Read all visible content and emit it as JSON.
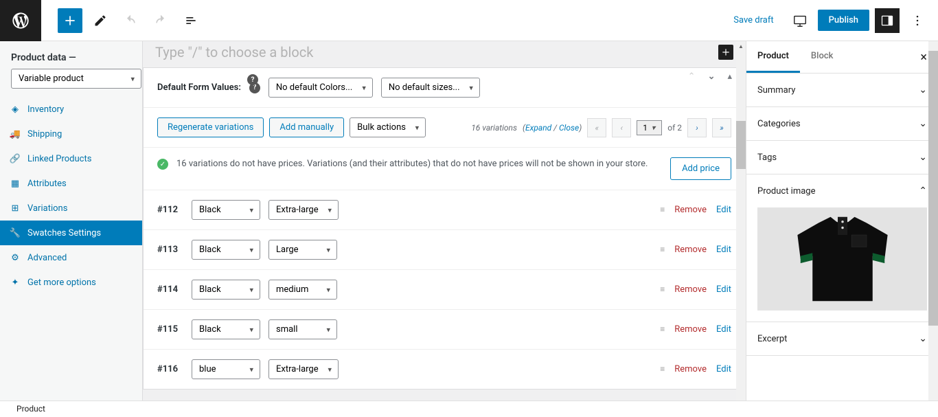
{
  "toolbar": {
    "save_draft": "Save draft",
    "publish": "Publish"
  },
  "block_hint": "Type \"/\" to choose a block",
  "product_data": {
    "label": "Product data —",
    "type_selected": "Variable product"
  },
  "sidebar_nav": [
    {
      "id": "inventory",
      "label": "Inventory",
      "active": false
    },
    {
      "id": "shipping",
      "label": "Shipping",
      "active": false
    },
    {
      "id": "linked",
      "label": "Linked Products",
      "active": false
    },
    {
      "id": "attributes",
      "label": "Attributes",
      "active": false
    },
    {
      "id": "variations",
      "label": "Variations",
      "active": false
    },
    {
      "id": "swatches",
      "label": "Swatches Settings",
      "active": true
    },
    {
      "id": "advanced",
      "label": "Advanced",
      "active": false
    },
    {
      "id": "getmore",
      "label": "Get more options",
      "active": false
    }
  ],
  "defaults": {
    "label": "Default Form Values:",
    "color_default": "No default Colors...",
    "size_default": "No default sizes..."
  },
  "actions": {
    "regenerate": "Regenerate variations",
    "add_manually": "Add manually",
    "bulk": "Bulk actions",
    "add_price": "Add price",
    "remove": "Remove",
    "edit": "Edit"
  },
  "pagination": {
    "count_text": "16 variations",
    "expand": "Expand",
    "close": "Close",
    "sep": " / ",
    "current_page": "1",
    "of_text": "of 2"
  },
  "notice": "16 variations do not have prices. Variations (and their attributes) that do not have prices will not be shown in your store.",
  "variations": [
    {
      "id": "#112",
      "color": "Black",
      "size": "Extra-large"
    },
    {
      "id": "#113",
      "color": "Black",
      "size": "Large"
    },
    {
      "id": "#114",
      "color": "Black",
      "size": "medium"
    },
    {
      "id": "#115",
      "color": "Black",
      "size": "small"
    },
    {
      "id": "#116",
      "color": "blue",
      "size": "Extra-large"
    }
  ],
  "right_tabs": {
    "product": "Product",
    "block": "Block"
  },
  "panels": {
    "summary": "Summary",
    "categories": "Categories",
    "tags": "Tags",
    "product_image": "Product image",
    "excerpt": "Excerpt"
  },
  "breadcrumb": "Product"
}
